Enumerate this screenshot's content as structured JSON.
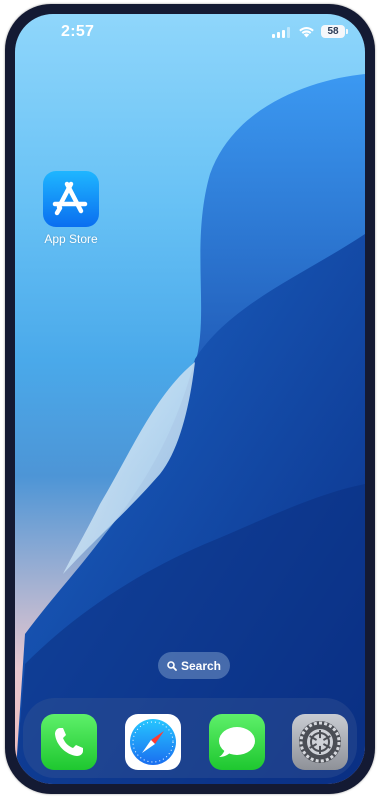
{
  "status_bar": {
    "time": "2:57",
    "battery_level": "58"
  },
  "home_screen": {
    "apps": [
      {
        "label": "App Store",
        "icon": "app-store-icon"
      }
    ],
    "search_label": "Search"
  },
  "dock": {
    "apps": [
      {
        "name": "Phone",
        "icon": "phone-icon"
      },
      {
        "name": "Safari",
        "icon": "safari-icon"
      },
      {
        "name": "Messages",
        "icon": "messages-icon"
      },
      {
        "name": "Settings",
        "icon": "settings-icon"
      }
    ]
  },
  "colors": {
    "frame": "#141a33",
    "app_store_blue": "#0a6ef0",
    "green_app": "#1ec72f"
  }
}
